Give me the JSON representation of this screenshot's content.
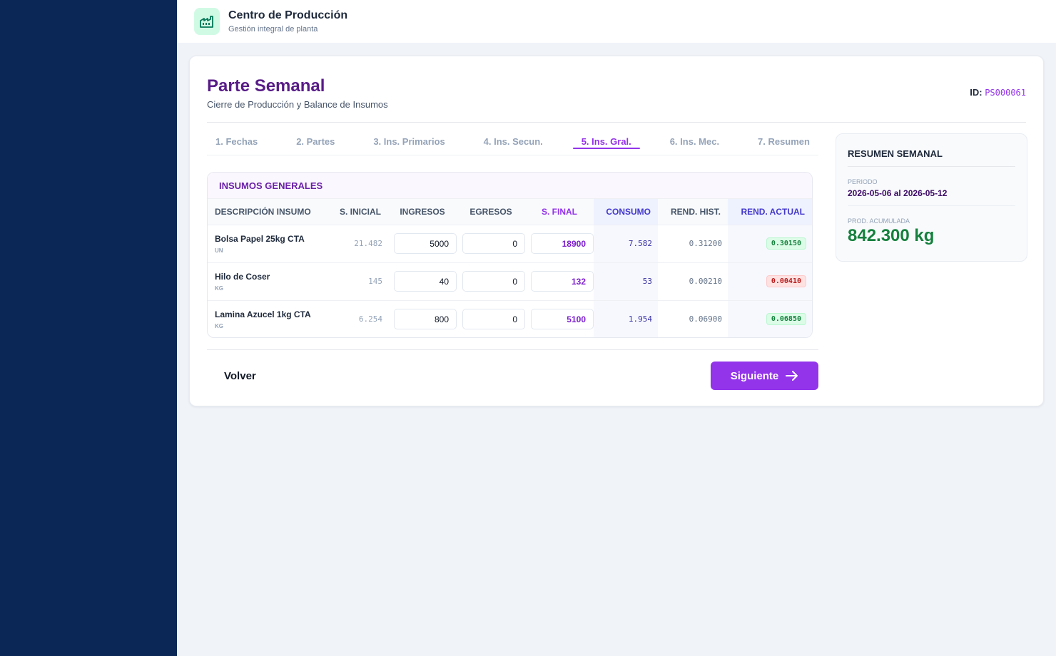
{
  "app": {
    "title": "Centro de Producción",
    "subtitle": "Gestión integral de planta",
    "logo_icon": "factory-icon"
  },
  "page": {
    "title": "Parte Semanal",
    "subtitle": "Cierre de Producción y Balance de Insumos",
    "id_label": "ID:",
    "id_value": "PS000061"
  },
  "tabs": [
    {
      "label": "1. Fechas",
      "active": false
    },
    {
      "label": "2. Partes",
      "active": false
    },
    {
      "label": "3. Ins. Primarios",
      "active": false
    },
    {
      "label": "4. Ins. Secun.",
      "active": false
    },
    {
      "label": "5. Ins. Gral.",
      "active": true
    },
    {
      "label": "6. Ins. Mec.",
      "active": false
    },
    {
      "label": "7. Resumen",
      "active": false
    }
  ],
  "table": {
    "title": "INSUMOS GENERALES",
    "columns": [
      "DESCRIPCIÓN INSUMO",
      "S. INICIAL",
      "INGRESOS",
      "EGRESOS",
      "S. FINAL",
      "CONSUMO",
      "REND. HIST.",
      "REND. ACTUAL"
    ],
    "rows": [
      {
        "name": "Bolsa Papel 25kg CTA",
        "unit": "UN",
        "s_inicial": "21.482",
        "ingresos": "5000",
        "egresos": "0",
        "s_final": "18900",
        "consumo": "7.582",
        "rend_hist": "0.31200",
        "rend_actual": "0.30150",
        "status": "good"
      },
      {
        "name": "Hilo de Coser",
        "unit": "KG",
        "s_inicial": "145",
        "ingresos": "40",
        "egresos": "0",
        "s_final": "132",
        "consumo": "53",
        "rend_hist": "0.00210",
        "rend_actual": "0.00410",
        "status": "bad"
      },
      {
        "name": "Lamina Azucel 1kg CTA",
        "unit": "KG",
        "s_inicial": "6.254",
        "ingresos": "800",
        "egresos": "0",
        "s_final": "5100",
        "consumo": "1.954",
        "rend_hist": "0.06900",
        "rend_actual": "0.06850",
        "status": "good"
      }
    ]
  },
  "actions": {
    "back": "Volver",
    "next": "Siguiente"
  },
  "summary": {
    "title": "RESUMEN SEMANAL",
    "period_label": "PERIODO",
    "period_value": "2026-05-06 al 2026-05-12",
    "prod_label": "PROD. ACUMULADA",
    "prod_value": "842.300 kg"
  },
  "colors": {
    "sidebar": "#0b2756",
    "accent": "#9333ea",
    "good": "#15803d",
    "bad": "#b91c1c"
  }
}
